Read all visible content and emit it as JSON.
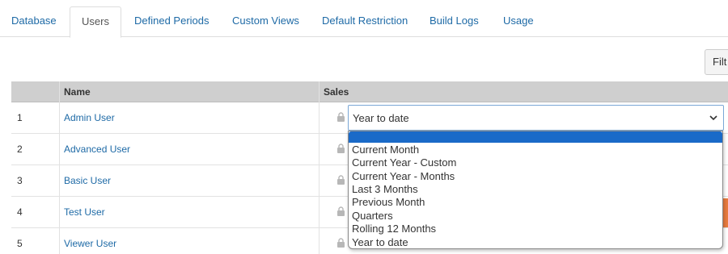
{
  "tabs": [
    {
      "label": "Database",
      "active": false
    },
    {
      "label": "Users",
      "active": true
    },
    {
      "label": "Defined Periods",
      "active": false
    },
    {
      "label": "Custom Views",
      "active": false
    },
    {
      "label": "Default Restriction",
      "active": false
    },
    {
      "label": "Build Logs",
      "active": false
    },
    {
      "label": "Usage",
      "active": false
    }
  ],
  "filter_button": {
    "label": "Filt"
  },
  "table": {
    "columns": [
      "",
      "Name",
      "Sales"
    ],
    "rows": [
      {
        "num": "1",
        "name": "Admin User"
      },
      {
        "num": "2",
        "name": "Advanced User"
      },
      {
        "num": "3",
        "name": "Basic User"
      },
      {
        "num": "4",
        "name": "Test User"
      },
      {
        "num": "5",
        "name": "Viewer User"
      }
    ]
  },
  "sales_select": {
    "value": "Year to date",
    "options": [
      "",
      "Current Month",
      "Current Year - Custom",
      "Current Year - Months",
      "Last 3 Months",
      "Previous Month",
      "Quarters",
      "Rolling 12 Months",
      "Year to date"
    ]
  },
  "colors": {
    "link": "#1e6aa6",
    "highlight": "#1a6ac8",
    "header_bg": "#cfcfcf"
  }
}
